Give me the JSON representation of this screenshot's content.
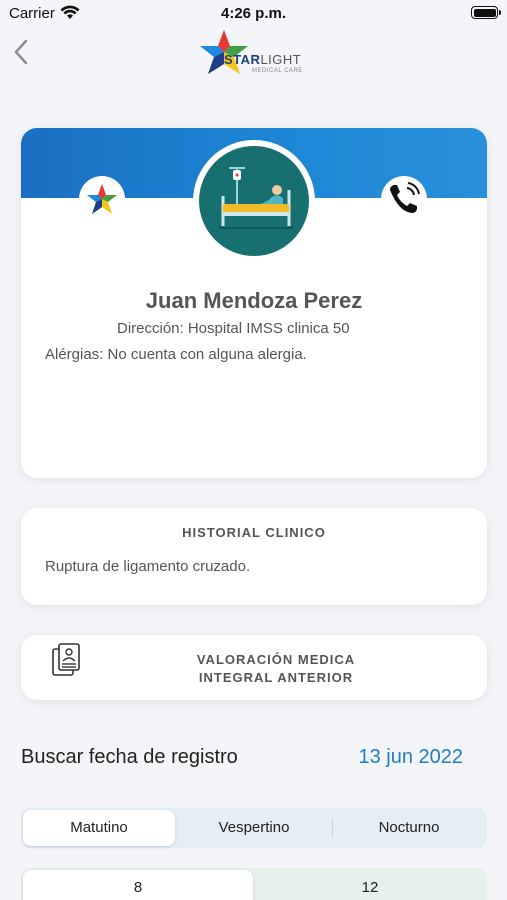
{
  "status_bar": {
    "carrier": "Carrier",
    "time": "4:26 p.m."
  },
  "header": {
    "logo_primary": "STAR",
    "logo_secondary": "LIGHT",
    "logo_sub": "MEDICAL CARE"
  },
  "patient": {
    "name": "Juan Mendoza Perez",
    "address": "Dirección: Hospital IMSS clinica 50",
    "allergies": "Alérgias: No cuenta con alguna alergia."
  },
  "history": {
    "title": "HISTORIAL CLINICO",
    "text": "Ruptura de ligamento cruzado."
  },
  "valoracion": {
    "label": "VALORACIÓN MEDICA\nINTEGRAL ANTERIOR"
  },
  "search": {
    "label": "Buscar fecha de registro",
    "date": "13 jun 2022"
  },
  "shifts": {
    "options": [
      "Matutino",
      "Vespertino",
      "Nocturno"
    ],
    "selected": "Matutino"
  },
  "numbers": {
    "options": [
      "8",
      "12"
    ],
    "selected": "8"
  },
  "colors": {
    "accent_blue": "#1e88d6",
    "date_blue": "#1f7ec4",
    "avatar_teal": "#17706f"
  }
}
